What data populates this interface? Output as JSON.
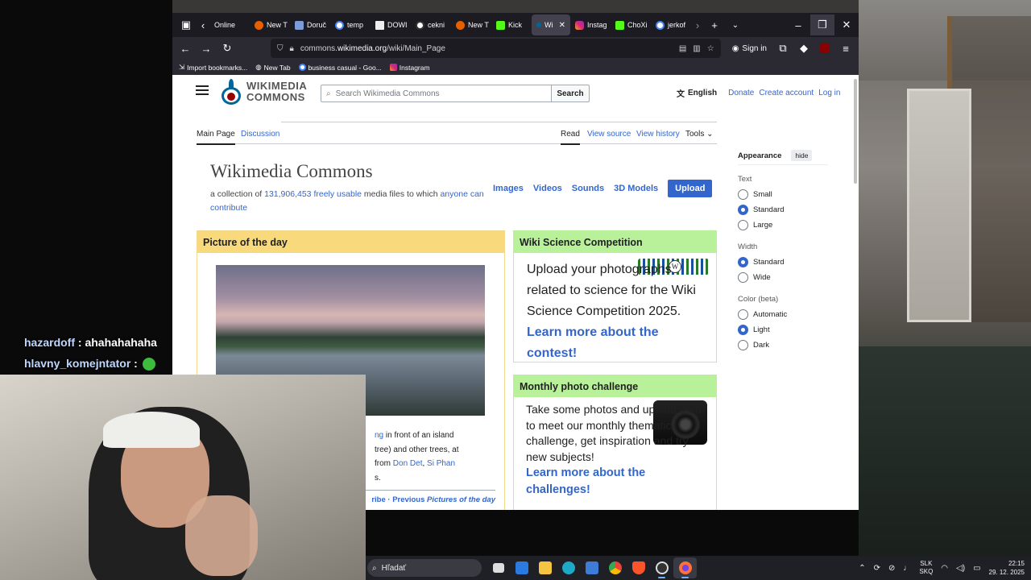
{
  "colors": {
    "accent": "#3366cc",
    "potd_header": "#f8da7d",
    "green_header": "#b9f19a",
    "browser_bg": "#1c1b22"
  },
  "chat": [
    {
      "user": "hazardoff",
      "message": ": ahahahahaha"
    },
    {
      "user": "hlavny_komejntator",
      "message": ":"
    }
  ],
  "browser": {
    "tabs": [
      {
        "label": "Online",
        "icon": "tab-icon"
      },
      {
        "label": "New T",
        "icon": "firefox-icon"
      },
      {
        "label": "Doruč",
        "icon": "page-icon"
      },
      {
        "label": "temp",
        "icon": "google-icon"
      },
      {
        "label": "DOWI",
        "icon": "page-icon"
      },
      {
        "label": "cekni",
        "icon": "chatgpt-icon"
      },
      {
        "label": "New T",
        "icon": "firefox-icon"
      },
      {
        "label": "Kick",
        "icon": "kick-icon"
      },
      {
        "label": "Wi",
        "icon": "wikimedia-icon"
      },
      {
        "label": "Instag",
        "icon": "instagram-icon"
      },
      {
        "label": "ChoXi",
        "icon": "kick-icon"
      },
      {
        "label": "jerkof",
        "icon": "google-icon"
      }
    ],
    "url_prefix": "commons.",
    "url_domain": "wikimedia.org",
    "url_path": "/wiki/Main_Page",
    "sign_in": "Sign in",
    "bookmarks": [
      "Import bookmarks...",
      "New Tab",
      "business casual - Goo...",
      "Instagram"
    ]
  },
  "page": {
    "logo_line1": "WIKIMEDIA",
    "logo_line2": "COMMONS",
    "search_placeholder": "Search Wikimedia Commons",
    "search_button": "Search",
    "language": "English",
    "donate": "Donate",
    "create_account": "Create account",
    "log_in": "Log in",
    "tab_main": "Main Page",
    "tab_discussion": "Discussion",
    "tab_read": "Read",
    "tab_view_source": "View source",
    "tab_view_history": "View history",
    "tab_tools": "Tools",
    "title": "Wikimedia Commons",
    "subtitle_a": "a collection of ",
    "subtitle_count": "131,906,453",
    "subtitle_b": " ",
    "subtitle_freely": "freely usable",
    "subtitle_c": " media files to which ",
    "subtitle_anyone": "anyone can contribute",
    "quick_links": [
      "Images",
      "Videos",
      "Sounds",
      "3D Models"
    ],
    "upload": "Upload",
    "potd_title": "Picture of the day",
    "potd_text_a": "ng",
    "potd_text_b": " in front of an island",
    "potd_text_c": " tree) and other trees, at",
    "potd_text_d": "from ",
    "potd_text_e": "Don Det",
    "potd_text_f": ", ",
    "potd_text_g": "Si Phan",
    "potd_text_h": "s.",
    "potd_foot_a": "ribe",
    "potd_foot_b": " · Previous ",
    "potd_foot_c": "Pictures of the day",
    "wsc_title": "Wiki Science Competition",
    "wsc_text": "Upload your photographs related to science for the Wiki Science Competition 2025.",
    "wsc_link": "Learn more about the contest!",
    "wsc_logo_letter": "W",
    "mpc_title": "Monthly photo challenge",
    "mpc_text": "Take some photos and upload them to meet our monthly thematic challenge, get inspiration and try new subjects!",
    "mpc_link": "Learn more about the challenges!",
    "appearance": {
      "title": "Appearance",
      "hide": "hide",
      "text_label": "Text",
      "text_options": [
        "Small",
        "Standard",
        "Large"
      ],
      "text_selected": "Standard",
      "width_label": "Width",
      "width_options": [
        "Standard",
        "Wide"
      ],
      "width_selected": "Standard",
      "color_label": "Color (beta)",
      "color_options": [
        "Automatic",
        "Light",
        "Dark"
      ],
      "color_selected": "Light"
    }
  },
  "taskbar": {
    "search_placeholder": "Hľadať",
    "keyboard_line1": "SLK",
    "keyboard_line2": "SKQ",
    "time": "22:15",
    "date": "29. 12. 2025"
  }
}
